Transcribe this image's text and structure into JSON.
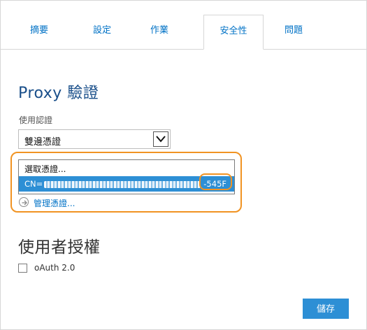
{
  "tabs": [
    {
      "label": "摘要"
    },
    {
      "label": "設定"
    },
    {
      "label": "作業"
    },
    {
      "label": "安全性",
      "active": true
    },
    {
      "label": "問題"
    }
  ],
  "proxy_section": {
    "title": "Proxy 驗證",
    "field_label": "使用認證",
    "select_value": "雙邊憑證",
    "list_options": [
      {
        "label": "選取憑證..."
      },
      {
        "label_prefix": "CN=",
        "label_suffix": "-545F",
        "selected": true
      }
    ],
    "manage_link": "管理憑證..."
  },
  "user_section": {
    "title": "使用者授權",
    "checkbox_label": "oAuth 2.0",
    "checkbox_checked": false
  },
  "footer": {
    "save_label": "儲存"
  },
  "colors": {
    "accent": "#0072c6",
    "button": "#2d8fd5",
    "highlight": "#f19322",
    "heading": "#1a4f8a"
  }
}
